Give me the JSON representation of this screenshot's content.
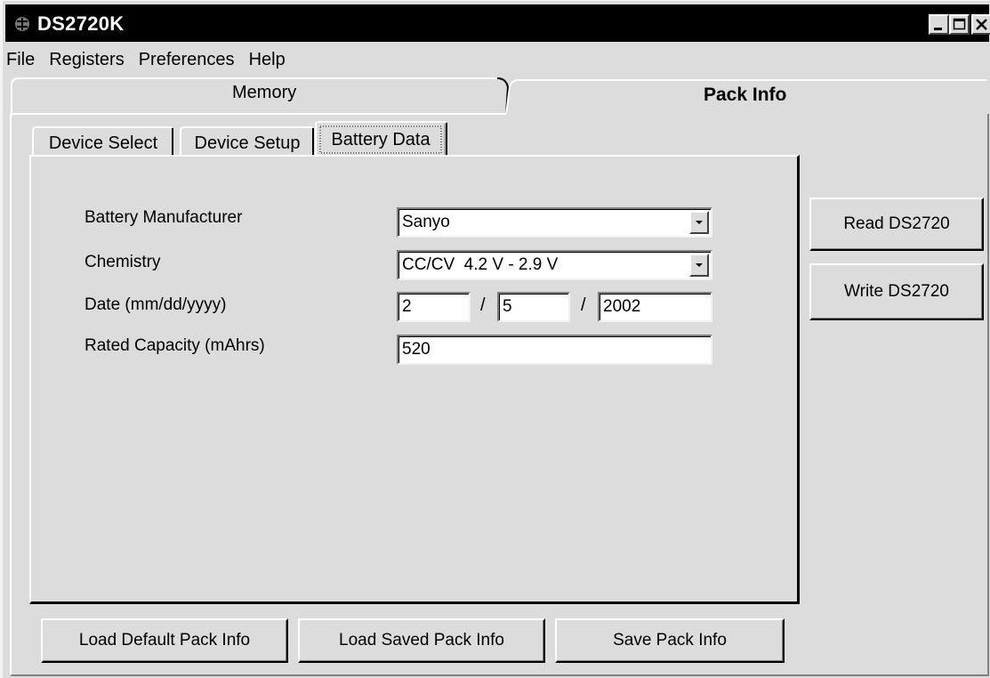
{
  "window": {
    "title": "DS2720K"
  },
  "menu": {
    "items": [
      "File",
      "Registers",
      "Preferences",
      "Help"
    ]
  },
  "outer_tabs": {
    "memory": "Memory",
    "pack_info": "Pack Info"
  },
  "inner_tabs": {
    "device_select": "Device Select",
    "device_setup": "Device Setup",
    "battery_data": "Battery Data"
  },
  "battery_data": {
    "manufacturer_label": "Battery Manufacturer",
    "manufacturer_value": "Sanyo",
    "chemistry_label": "Chemistry",
    "chemistry_value": "CC/CV  4.2 V - 2.9 V",
    "date_label": "Date (mm/dd/yyyy)",
    "date_month": "2",
    "date_day": "5",
    "date_year": "2002",
    "date_sep": "/",
    "capacity_label": "Rated Capacity (mAhrs)",
    "capacity_value": "520"
  },
  "side_buttons": {
    "read": "Read DS2720",
    "write": "Write DS2720"
  },
  "bottom_buttons": {
    "load_default": "Load Default Pack Info",
    "load_saved": "Load Saved Pack Info",
    "save": "Save Pack Info"
  }
}
